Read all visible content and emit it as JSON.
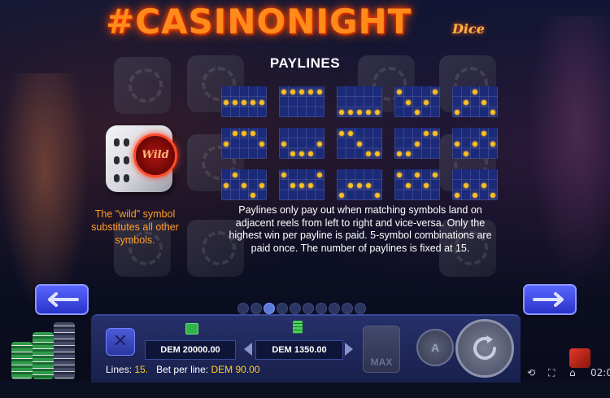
{
  "logo": {
    "title": "#CASINONIGHT",
    "subtitle": "Dice"
  },
  "heading": "PAYLINES",
  "wild": {
    "badge_label": "Wild",
    "description": "The \"wild\" symbol substitutes all other symbols."
  },
  "paylines_description": "Paylines only pay out when matching symbols land on adjacent reels from left to right and vice-versa. Only the highest win per payline is paid. 5-symbol combinations are paid once. The number of paylines is fixed at 15.",
  "paylines": [
    [
      1,
      1,
      1,
      1,
      1
    ],
    [
      0,
      0,
      0,
      0,
      0
    ],
    [
      2,
      2,
      2,
      2,
      2
    ],
    [
      0,
      1,
      2,
      1,
      0
    ],
    [
      2,
      1,
      0,
      1,
      2
    ],
    [
      1,
      0,
      0,
      0,
      1
    ],
    [
      1,
      2,
      2,
      2,
      1
    ],
    [
      0,
      0,
      1,
      2,
      2
    ],
    [
      2,
      2,
      1,
      0,
      0
    ],
    [
      1,
      2,
      1,
      0,
      1
    ],
    [
      1,
      0,
      1,
      2,
      1
    ],
    [
      0,
      1,
      1,
      1,
      0
    ],
    [
      2,
      1,
      1,
      1,
      2
    ],
    [
      0,
      1,
      0,
      1,
      0
    ],
    [
      2,
      1,
      2,
      1,
      2
    ]
  ],
  "pagination": {
    "total": 10,
    "current": 3
  },
  "console": {
    "balance": "DEM 20000.00",
    "bet": "DEM 1350.00",
    "lines_label": "Lines:",
    "lines_value": "15.",
    "bet_per_line_label": "Bet per line:",
    "bet_per_line_value": "DEM 90.00",
    "max_label": "MAX",
    "auto_label": "A",
    "clear_label": "✕"
  },
  "status": {
    "time": "02:0"
  },
  "colors": {
    "dot": "#ffbf1f",
    "accent": "#ff9e2a",
    "button": "#3a45e0"
  }
}
